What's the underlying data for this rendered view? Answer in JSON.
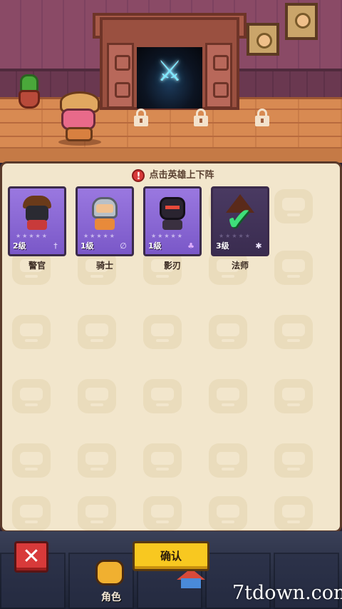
{
  "panel": {
    "hint": "点击英雄上下阵"
  },
  "heroes": [
    {
      "name": "警官",
      "level": "2级",
      "class_icon": "sword-icon",
      "active": true
    },
    {
      "name": "骑士",
      "level": "1级",
      "class_icon": "shield-icon",
      "active": true
    },
    {
      "name": "影刃",
      "level": "1级",
      "class_icon": "grape-icon",
      "active": true
    },
    {
      "name": "法师",
      "level": "3级",
      "class_icon": "spark-icon",
      "active": false,
      "selected": true
    }
  ],
  "buttons": {
    "confirm": "确认",
    "close_glyph": "✕"
  },
  "nav": {
    "character_label": "角色"
  },
  "watermark": "7tdown.com",
  "colors": {
    "card_active": "#9a78e0",
    "card_inactive": "#4a3a62",
    "confirm": "#f8c820",
    "close": "#d83a3a",
    "check": "#3ee07a"
  }
}
